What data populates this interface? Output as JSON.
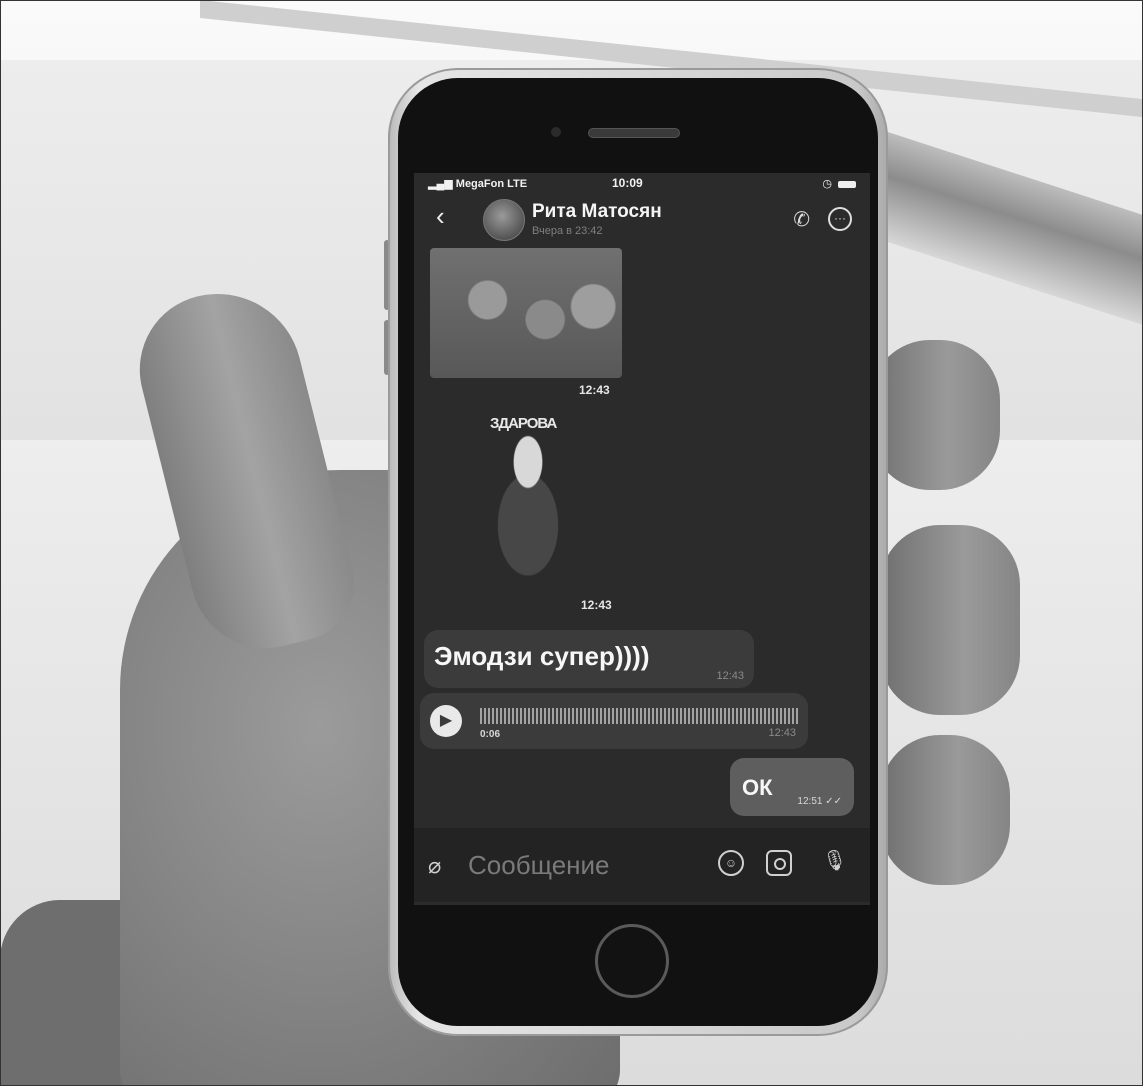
{
  "status_bar": {
    "carrier": "MegaFon",
    "network": "LTE",
    "time": "10:09"
  },
  "header": {
    "back_icon": "chevron-left-icon",
    "contact_name": "Рита Матосян",
    "last_seen": "Вчера в 23:42",
    "call_icon": "phone-icon",
    "more_icon": "ellipsis-icon"
  },
  "messages": [
    {
      "type": "sticker",
      "time": "12:43"
    },
    {
      "type": "sticker",
      "caption": "ЗДАРОВА",
      "time": "12:43"
    },
    {
      "type": "text",
      "direction": "in",
      "text": "Эмодзи супер))))",
      "time": "12:43"
    },
    {
      "type": "voice",
      "direction": "in",
      "duration": "0:06",
      "time": "12:43"
    },
    {
      "type": "text",
      "direction": "out",
      "text": "ОК",
      "time": "12:51"
    }
  ],
  "composer": {
    "placeholder": "Сообщение",
    "attach_icon": "paperclip-icon",
    "emoji_icon": "smile-icon",
    "camera_icon": "camera-icon",
    "mic_icon": "microphone-icon"
  },
  "colors": {
    "screen_bg": "#2b2b2b",
    "bubble_in": "#3b3b3b",
    "bubble_out": "#5e5e5e"
  }
}
